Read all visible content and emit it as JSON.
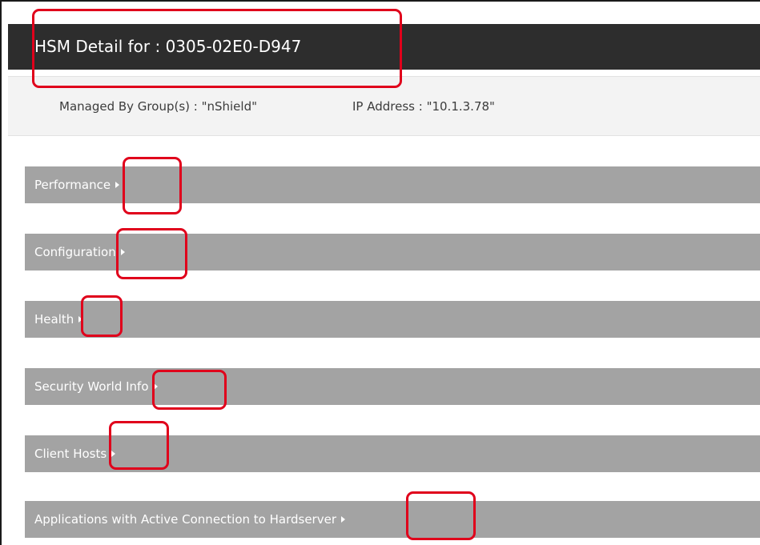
{
  "hsm": {
    "title": "HSM Detail for : 0305-02E0-D947",
    "managed_by": "Managed By Group(s) : \"nShield\"",
    "ip_address": "IP Address : \"10.1.3.78\""
  },
  "sections": [
    {
      "label": "Performance"
    },
    {
      "label": "Configuration"
    },
    {
      "label": "Health"
    },
    {
      "label": "Security World Info"
    },
    {
      "label": "Client Hosts"
    },
    {
      "label": "Applications with Active Connection to Hardserver"
    }
  ],
  "colors": {
    "title_bar": "#2d2d2d",
    "section_bar": "#a3a3a3",
    "annotation": "#e0001b"
  },
  "icons": {
    "section_expand": "triangle-right-icon"
  }
}
